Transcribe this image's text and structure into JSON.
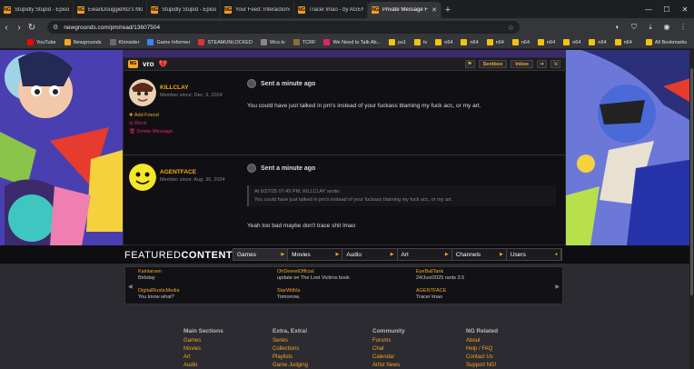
{
  "browser": {
    "tabs": [
      {
        "title": "Stupidly Stupid - Episode 6 - Jm",
        "active": false
      },
      {
        "title": "EwanDouggieNG's Movies",
        "active": false
      },
      {
        "title": "Stupidly Stupid - Episode 6 - Jm",
        "active": false
      },
      {
        "title": "Your Feed: Interactions",
        "active": false
      },
      {
        "title": "Tracer lmao - by AGENTFACE",
        "active": false
      },
      {
        "title": "Private Message From: KILL",
        "active": true
      }
    ],
    "new_tab_label": "+",
    "url": "newgrounds.com/pm/read/13607504",
    "bookmarks": [
      {
        "label": "YouTube",
        "color": "#ff0000"
      },
      {
        "label": "Newgrounds",
        "color": "#f6a623"
      },
      {
        "label": "Khinsider",
        "color": "#6b6b6b"
      },
      {
        "label": "Game Informer",
        "color": "#3b82f6"
      },
      {
        "label": "STEAMUNLOCKED",
        "color": "#d33"
      },
      {
        "label": "Wco.tv",
        "color": "#888"
      },
      {
        "label": "TCRF",
        "color": "#8a6d3b"
      },
      {
        "label": "We Need to Talk Ab...",
        "color": "#e0245e"
      },
      {
        "label": "ps1",
        "color": "#f1c40f"
      },
      {
        "label": "tv",
        "color": "#f1c40f"
      },
      {
        "label": "n64",
        "color": "#f1c40f"
      },
      {
        "label": "n64",
        "color": "#f1c40f"
      },
      {
        "label": "n64",
        "color": "#f1c40f"
      },
      {
        "label": "n64",
        "color": "#f1c40f"
      },
      {
        "label": "n64",
        "color": "#f1c40f"
      },
      {
        "label": "n64",
        "color": "#f1c40f"
      },
      {
        "label": "n64",
        "color": "#f1c40f"
      },
      {
        "label": "n64",
        "color": "#f1c40f"
      }
    ],
    "all_bookmarks": "All Bookmarks"
  },
  "pm": {
    "subject": "vro",
    "sentbox_label": "Sentbox",
    "inbox_label": "Inbox",
    "messages": [
      {
        "author": "KILLCLAY",
        "member_since": "Member since: Dec. 9, 2024",
        "sent": "Sent a minute ago",
        "text": "You could have just talked in pm's instead of your fuckass blaming my fuck acc, or my art.",
        "actions": {
          "add_friend": "Add Friend",
          "block": "Block",
          "delete": "Delete Message"
        }
      },
      {
        "author": "AGENTFACE",
        "member_since": "Member since: Aug. 30, 2024",
        "sent": "Sent a minute ago",
        "quote_header": "At 6/27/25 07:49 PM, KILLCLAY wrote:",
        "quote_body": "You could have just talked in pm's instead of your fuckass blaming my fuck acc, or my art.",
        "text": "Yeah too bad maybe don't trace shit lmao"
      }
    ]
  },
  "featured": {
    "title_a": "FEATURED",
    "title_b": "CONTENT",
    "tabs": [
      "Games",
      "Movies",
      "Audio",
      "Art",
      "Channels",
      "Users"
    ],
    "items": [
      {
        "title": "Kainlarsen",
        "sub": "Birbday"
      },
      {
        "title": "OhDeeretOfficial",
        "sub": "update on The Lost Victims book"
      },
      {
        "title": "EyeBallTank",
        "sub": "24/Jun/2025 rants 3.5"
      },
      {
        "title": "DigitalRusticMedia",
        "sub": "You know what?"
      },
      {
        "title": "StarWithIs",
        "sub": "Tomorrow."
      },
      {
        "title": "AGENTFACE",
        "sub": "Tracer lmao"
      }
    ]
  },
  "footer": {
    "columns": [
      {
        "heading": "Main Sections",
        "links": [
          "Games",
          "Movies",
          "Art",
          "Audio"
        ]
      },
      {
        "heading": "Extra, Extra!",
        "links": [
          "Series",
          "Collections",
          "Playlists",
          "Game Judging"
        ]
      },
      {
        "heading": "Community",
        "links": [
          "Forums",
          "Chat",
          "Calendar",
          "Artist News"
        ]
      },
      {
        "heading": "NG Related",
        "links": [
          "About",
          "Help / FAQ",
          "Contact Us",
          "Support NG!"
        ]
      }
    ]
  }
}
